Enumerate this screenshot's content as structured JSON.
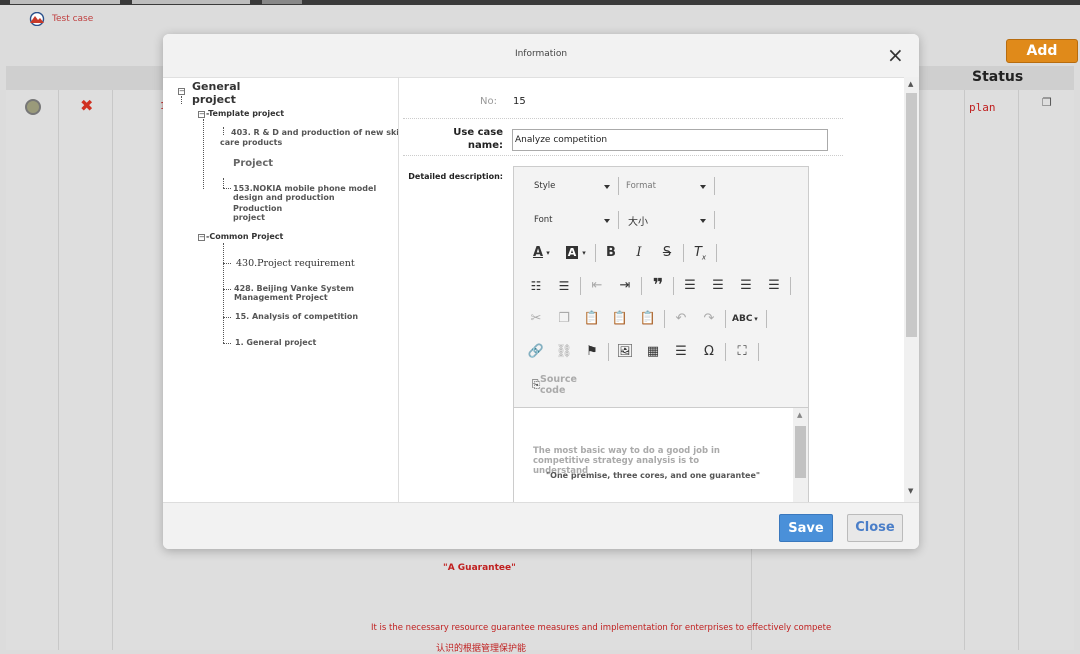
{
  "background": {
    "tab_title": "Test case",
    "add_label": "Add",
    "status_header": "Status",
    "status_value": "plan",
    "row_number": "1",
    "guarantee_text": "\"A Guarantee\"",
    "resource_text": "It is the necessary resource guarantee measures and implementation for enterprises to effectively compete",
    "cjk_text": "认识的根据管理保护能"
  },
  "modal": {
    "title": "Information",
    "close_icon": "×",
    "save_label": "Save",
    "close_label": "Close"
  },
  "tree": {
    "root": "General project",
    "root_toggle": "−",
    "template": {
      "label": "-Template project",
      "toggle": "−",
      "item1": "403. R & D and production of new skin care products",
      "project": "Project",
      "item2": "153.NOKIA mobile phone model design and production",
      "production": "Production project"
    },
    "common": {
      "label": "-Common Project",
      "toggle": "−",
      "items": [
        "430.Project requirement",
        "428. Beijing Vanke System Management Project",
        "15. Analysis of competition",
        "1. General project"
      ]
    }
  },
  "form": {
    "no_label": "No:",
    "no_value": "15",
    "name_label": "Use case name:",
    "name_value": "Analyze competition",
    "desc_label": "Detailed description:"
  },
  "editor": {
    "style": "Style",
    "format": "Format",
    "font": "Font",
    "size": "大小",
    "source": "Source code",
    "content_line1": "The most basic way to do a good job in competitive strategy analysis is to understand",
    "content_line2": "\"One premise, three cores, and one guarantee\""
  }
}
